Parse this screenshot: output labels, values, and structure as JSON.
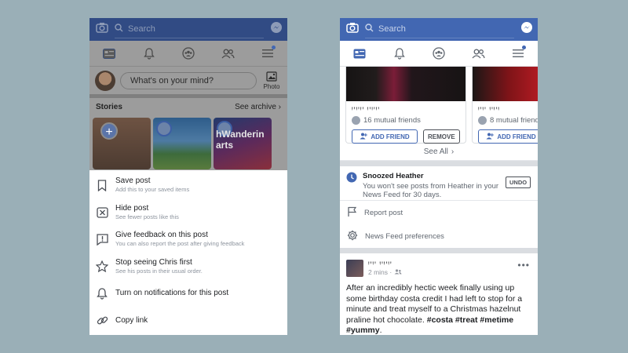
{
  "left": {
    "search_placeholder": "Search",
    "composer_placeholder": "What's on your mind?",
    "photo_label": "Photo",
    "stories_label": "Stories",
    "see_archive": "See archive",
    "story_text": "hWanderin arts",
    "menu": [
      {
        "title": "Save post",
        "subtitle": "Add this to your saved items",
        "icon": "bookmark-icon"
      },
      {
        "title": "Hide post",
        "subtitle": "See fewer posts like this",
        "icon": "hide-icon"
      },
      {
        "title": "Give feedback on this post",
        "subtitle": "You can also report the post after giving feedback",
        "icon": "feedback-icon"
      },
      {
        "title": "Stop seeing Chris first",
        "subtitle": "See his posts in their usual order.",
        "icon": "star-icon"
      },
      {
        "title": "Turn on notifications for this post",
        "subtitle": "",
        "icon": "bell-icon"
      },
      {
        "title": "Copy link",
        "subtitle": "",
        "icon": "link-icon"
      }
    ]
  },
  "right": {
    "search_placeholder": "Search",
    "cards": [
      {
        "name": "ꞋꞌꞋꞌꞋꞌ ꞋꞌꞋꞌꞋꞌ",
        "mutual": "16 mutual friends",
        "add_label": "ADD FRIEND",
        "remove_label": "REMOVE"
      },
      {
        "name": "ꞋꞌꞋꞌ ꞋꞌꞋꞌꞋ",
        "mutual": "8 mutual friends",
        "add_label": "ADD FRIEND"
      }
    ],
    "see_all": "See All",
    "snoozed_title": "Snoozed Heather",
    "snoozed_sub": "You won't see posts from Heather in your News Feed for 30 days.",
    "undo": "UNDO",
    "report_post": "Report post",
    "news_feed_prefs": "News Feed preferences",
    "post": {
      "name": "ꞋꞌꞋꞌ ꞋꞌꞋꞌꞋꞌ",
      "time": "2 mins ·",
      "text_before": "After an incredibly hectic week finally using up some birthday costa credit I had left to stop for a minute and treat myself to a Christmas hazelnut praline hot chocolate. ",
      "hashtags": "#costa #treat #metime #yummy",
      "text_after": "."
    }
  }
}
